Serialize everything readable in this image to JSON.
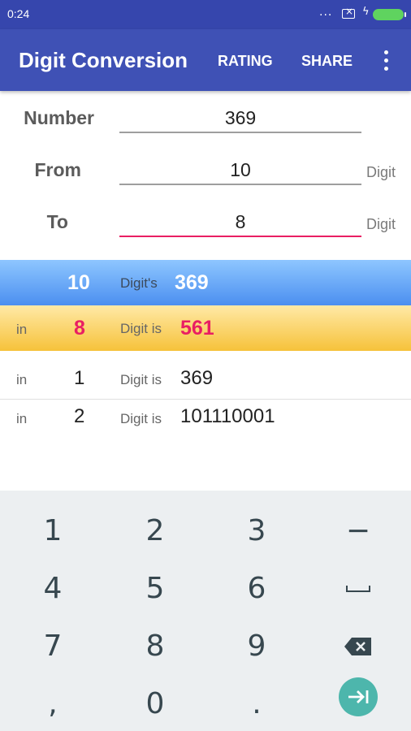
{
  "status_bar": {
    "time": "0:24",
    "dots": "..."
  },
  "app_bar": {
    "title": "Digit Conversion",
    "rating_label": "RATING",
    "share_label": "SHARE",
    "more_icon": "more-vert-icon"
  },
  "form": {
    "number_label": "Number",
    "number_value": "369",
    "from_label": "From",
    "from_value": "10",
    "from_unit": "Digit",
    "to_label": "To",
    "to_value": "8",
    "to_unit": "Digit"
  },
  "result": {
    "source_base": "10",
    "source_word": "Digit's",
    "source_value": "369",
    "target_prefix": "in",
    "target_base": "8",
    "target_word": "Digit is",
    "target_value": "561"
  },
  "conversions": [
    {
      "prefix": "in",
      "base": "1",
      "word": "Digit is",
      "value": "369"
    },
    {
      "prefix": "in",
      "base": "2",
      "word": "Digit is",
      "value": "101110001"
    }
  ],
  "keyboard": {
    "row1": [
      "1",
      "2",
      "3",
      "−"
    ],
    "row2": [
      "4",
      "5",
      "6"
    ],
    "row3": [
      "7",
      "8",
      "9"
    ],
    "row4": [
      ",",
      "0",
      "."
    ],
    "icons": {
      "space": "space-icon",
      "backspace": "backspace-icon",
      "enter": "enter-tab-icon"
    }
  },
  "colors": {
    "status_bar": "#3646ad",
    "app_bar": "#3f51b5",
    "accent": "#e91e63",
    "from_band": "#6aabf8",
    "to_band": "#f9d56a",
    "enter_key": "#4db6ac"
  }
}
